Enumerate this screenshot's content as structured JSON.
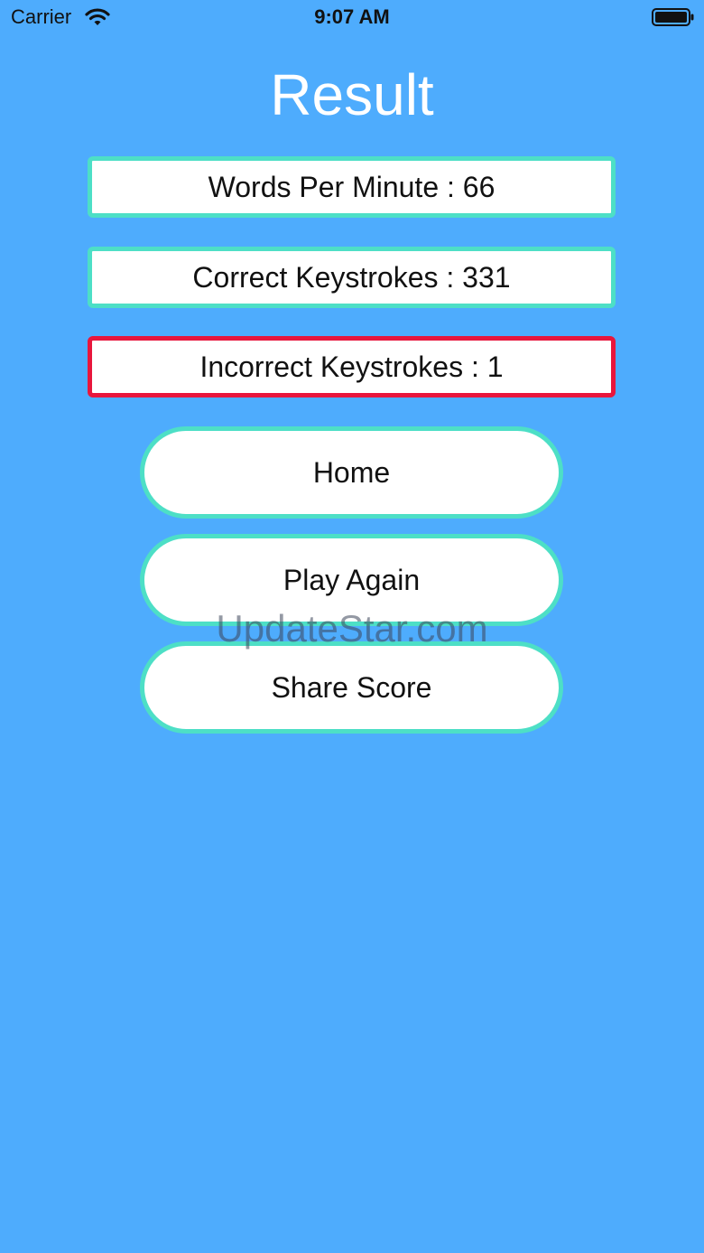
{
  "status_bar": {
    "carrier": "Carrier",
    "time": "9:07 AM",
    "icons": [
      "wifi-icon",
      "battery-icon"
    ]
  },
  "title": "Result",
  "stats": {
    "wpm": "Words Per Minute : 66",
    "correct": "Correct Keystrokes : 331",
    "incorrect": "Incorrect Keystrokes : 1"
  },
  "buttons": {
    "home": "Home",
    "play_again": "Play Again",
    "share": "Share Score"
  },
  "watermark": "UpdateStar.com",
  "colors": {
    "background": "#4eacfd",
    "accent_border": "#4ddfc6",
    "error_border": "#e8163c",
    "title": "#ffffff"
  }
}
